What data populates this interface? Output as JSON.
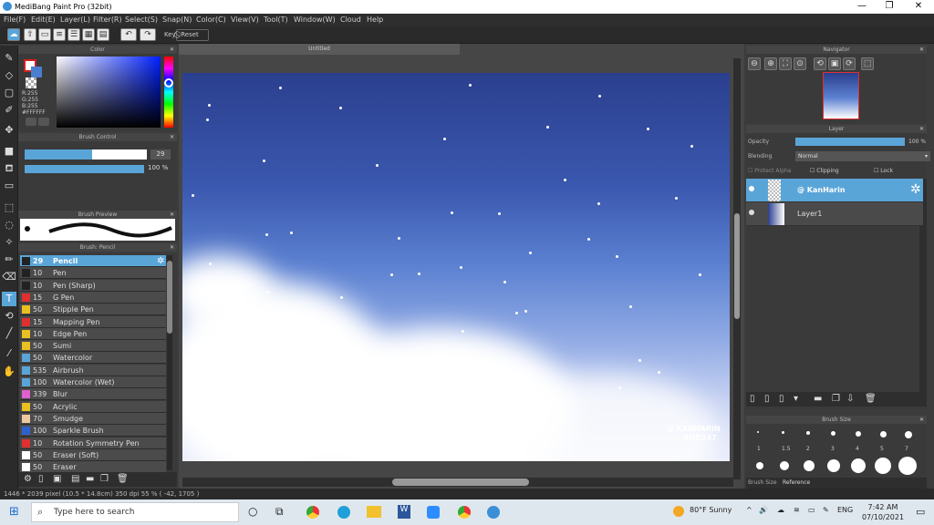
{
  "window": {
    "title": "MediBang Paint Pro (32bit)"
  },
  "menu": [
    "File(F)",
    "Edit(E)",
    "Layer(L)",
    "Filter(R)",
    "Select(S)",
    "Snap(N)",
    "Color(C)",
    "View(V)",
    "Tool(T)",
    "Window(W)",
    "Cloud",
    "Help"
  ],
  "toolbar": {
    "key_label": "Key",
    "reset_label": "Reset"
  },
  "color_panel": {
    "title": "Color",
    "r": "R:255",
    "g": "G:255",
    "b": "B:255",
    "hex": "#FFFFFF"
  },
  "brush_control": {
    "title": "Brush Control",
    "size_value": "29",
    "opacity_value": "100 %"
  },
  "brush_preview": {
    "title": "Brush Preview"
  },
  "brush_list": {
    "title": "Brush: Pencil",
    "items": [
      {
        "size": "29",
        "name": "Pencil",
        "color": "#222222"
      },
      {
        "size": "10",
        "name": "Pen",
        "color": "#222222"
      },
      {
        "size": "10",
        "name": "Pen (Sharp)",
        "color": "#222222"
      },
      {
        "size": "15",
        "name": "G Pen",
        "color": "#e03030"
      },
      {
        "size": "50",
        "name": "Stipple Pen",
        "color": "#e8c020"
      },
      {
        "size": "15",
        "name": "Mapping Pen",
        "color": "#e03030"
      },
      {
        "size": "10",
        "name": "Edge Pen",
        "color": "#e8c020"
      },
      {
        "size": "50",
        "name": "Sumi",
        "color": "#e8c020"
      },
      {
        "size": "50",
        "name": "Watercolor",
        "color": "#5aa5d8"
      },
      {
        "size": "535",
        "name": "Airbrush",
        "color": "#5aa5d8"
      },
      {
        "size": "100",
        "name": "Watercolor (Wet)",
        "color": "#5aa5d8"
      },
      {
        "size": "339",
        "name": "Blur",
        "color": "#e060d0"
      },
      {
        "size": "50",
        "name": "Acrylic",
        "color": "#e8c020"
      },
      {
        "size": "70",
        "name": "Smudge",
        "color": "#f0c8a0"
      },
      {
        "size": "100",
        "name": "Sparkle Brush",
        "color": "#3060d0"
      },
      {
        "size": "10",
        "name": "Rotation Symmetry Pen",
        "color": "#e03030"
      },
      {
        "size": "50",
        "name": "Eraser (Soft)",
        "color": "#ffffff"
      },
      {
        "size": "50",
        "name": "Eraser",
        "color": "#ffffff"
      }
    ]
  },
  "canvas": {
    "tab_title": "Untitled",
    "watermark_line1": "@ KANHARIN",
    "watermark_line2": "#HD247"
  },
  "navigator": {
    "title": "Navigator"
  },
  "layer_panel": {
    "title": "Layer",
    "opacity_label": "Opacity",
    "opacity_value": "100 %",
    "blending_label": "Blending",
    "blending_value": "Normal",
    "protect_alpha": "Protect Alpha",
    "clipping": "Clipping",
    "lock": "Lock",
    "layers": [
      {
        "name": "@ KanHarin",
        "selected": true
      },
      {
        "name": "Layer1",
        "selected": false
      }
    ]
  },
  "brush_size_panel": {
    "title": "Brush Size",
    "sizes": [
      "1",
      "1.5",
      "2",
      "3",
      "4",
      "5",
      "7"
    ],
    "tab_brush_size": "Brush Size",
    "tab_reference": "Reference"
  },
  "status": {
    "text": "1446 * 2039 pixel  (10.5 * 14.8cm)  350 dpi  55 %  ( -42, 1705 )"
  },
  "taskbar": {
    "search_placeholder": "Type here to search",
    "weather": "80°F  Sunny",
    "lang": "ENG",
    "time": "7:42 AM",
    "date": "07/10/2021"
  },
  "colors": {
    "accent": "#5aa5d8",
    "panel": "#3c3c3c"
  }
}
